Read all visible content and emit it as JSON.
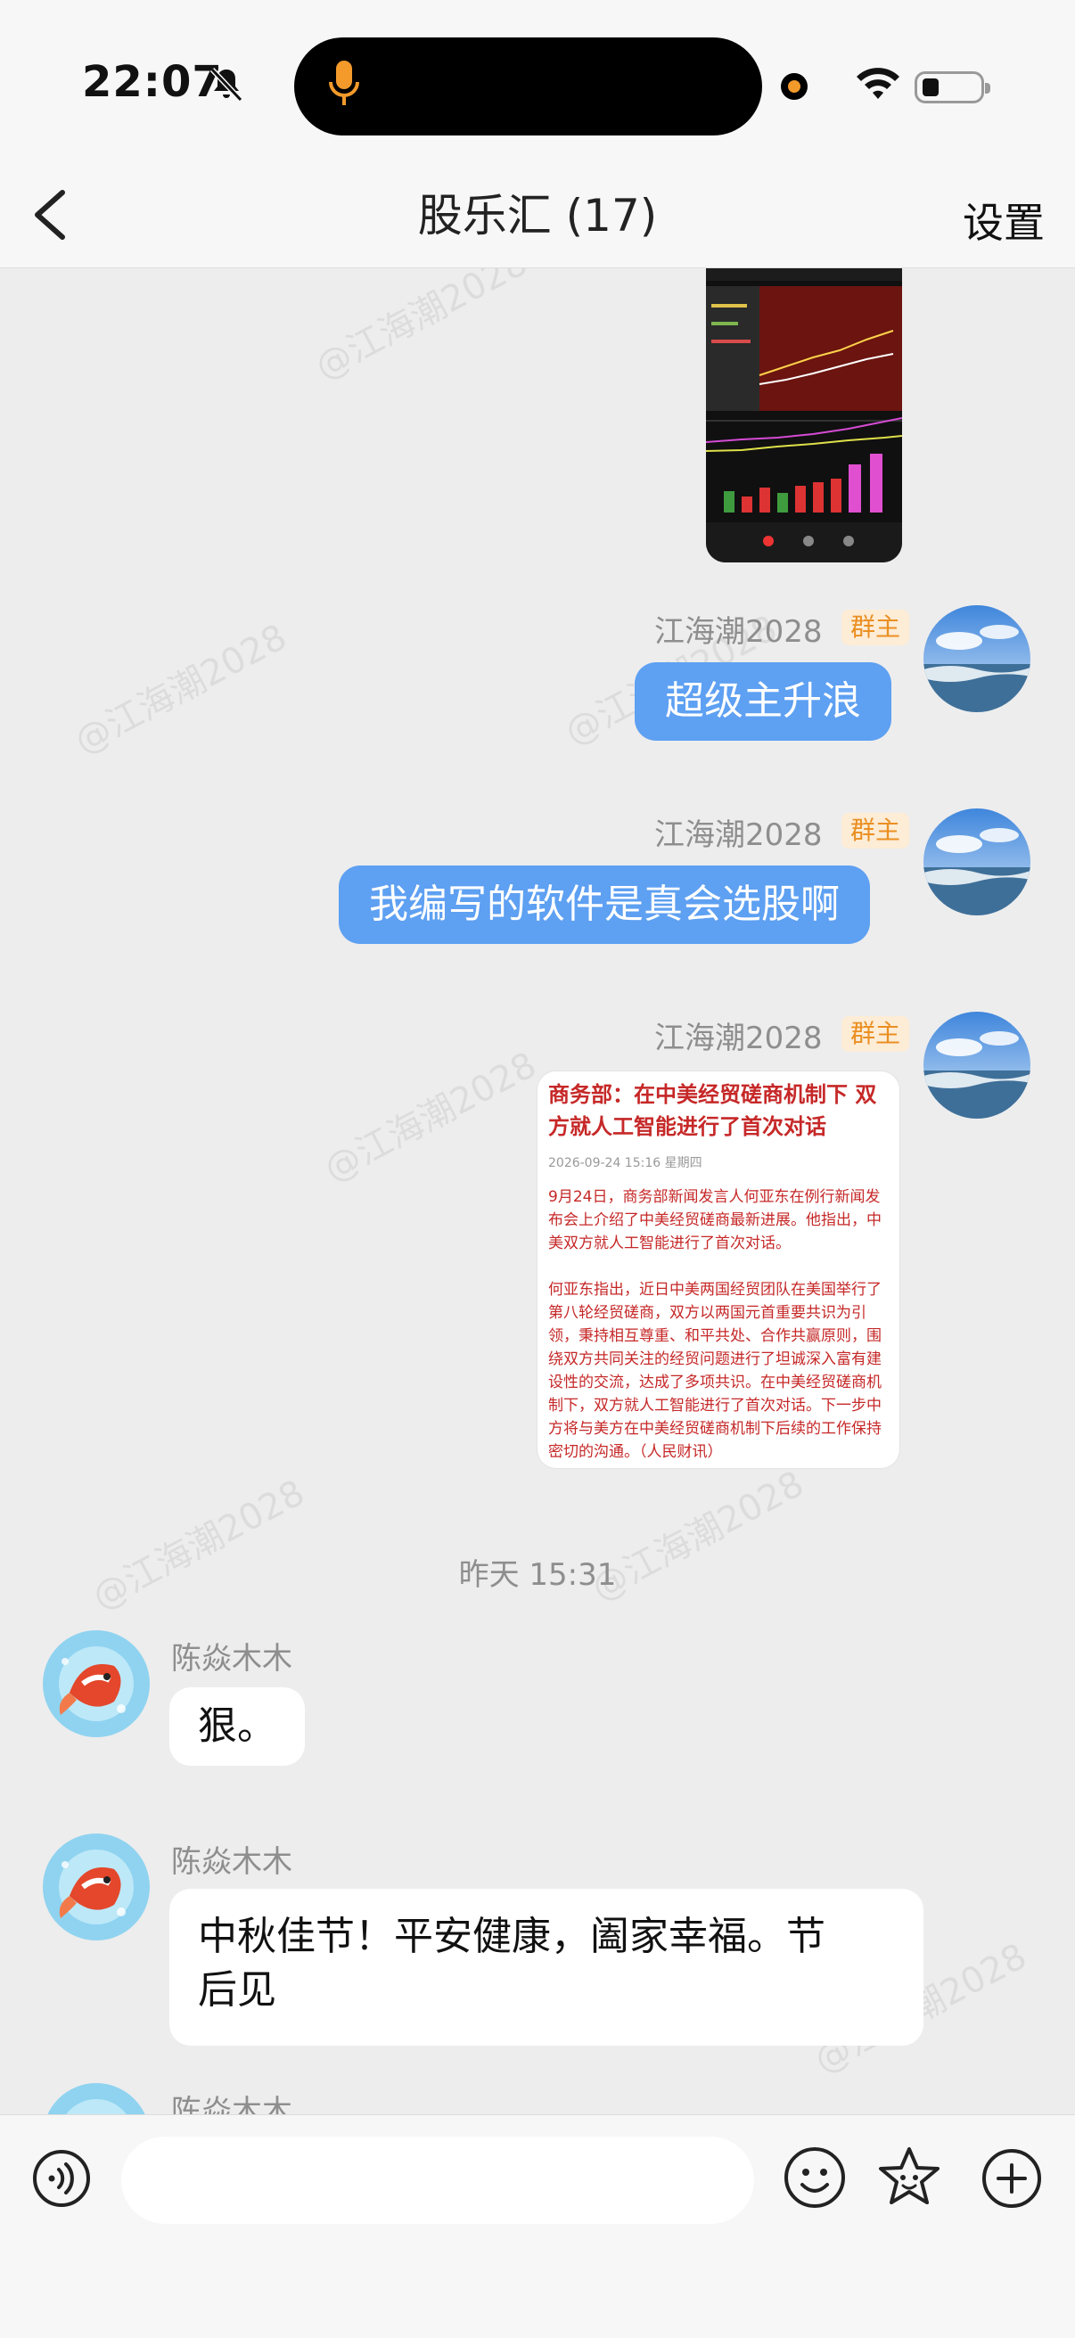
{
  "status_bar": {
    "time": "22:07",
    "icons": [
      "bell-slash-icon",
      "microphone-icon",
      "recording-dot-icon",
      "wifi-icon",
      "battery-icon"
    ]
  },
  "nav": {
    "back_icon": "chevron-left-icon",
    "title": "股乐汇 (17)",
    "settings_label": "设置"
  },
  "watermark_text": "@江海潮2028",
  "messages": [
    {
      "id": "m1",
      "side": "right",
      "sender": "江海潮2028",
      "role": "群主",
      "type": "text",
      "text": "超级主升浪"
    },
    {
      "id": "m2",
      "side": "right",
      "sender": "江海潮2028",
      "role": "群主",
      "type": "text",
      "text": "我编写的软件是真会选股啊"
    },
    {
      "id": "m3",
      "side": "right",
      "sender": "江海潮2028",
      "role": "群主",
      "type": "image",
      "news": {
        "title": "商务部：在中美经贸磋商机制下 双方就人工智能进行了首次对话",
        "date": "2026-09-24 15:16 星期四",
        "para1": "9月24日，商务部新闻发言人何亚东在例行新闻发布会上介绍了中美经贸磋商最新进展。他指出，中美双方就人工智能进行了首次对话。",
        "para2": "何亚东指出，近日中美两国经贸团队在美国举行了第八轮经贸磋商，双方以两国元首重要共识为引领，秉持相互尊重、和平共处、合作共赢原则，围绕双方共同关注的经贸问题进行了坦诚深入富有建设性的交流，达成了多项共识。在中美经贸磋商机制下，双方就人工智能进行了首次对话。下一步中方将与美方在中美经贸磋商机制下后续的工作保持密切的沟通。（人民财讯）"
      }
    },
    {
      "id": "sep",
      "type": "time",
      "text": "昨天 15:31"
    },
    {
      "id": "m4",
      "side": "left",
      "sender": "陈焱木木",
      "type": "text",
      "text": "狠。"
    },
    {
      "id": "m5",
      "side": "left",
      "sender": "陈焱木木",
      "type": "text",
      "text_line1": "中秋佳节！平安健康，阖家幸福。节",
      "text_line2": "后见"
    },
    {
      "id": "m6",
      "side": "left",
      "sender": "陈焱木木"
    }
  ],
  "input_bar": {
    "voice_icon": "voice-icon",
    "placeholder": "",
    "emoji_icon": "emoji-icon",
    "sticker_icon": "sticker-icon",
    "plus_icon": "plus-icon"
  },
  "colors": {
    "bubble_blue": "#5ea0f2",
    "background": "#ededed",
    "badge_bg": "#fdecd6",
    "badge_text": "#ea8f22",
    "news_red": "#c62828"
  }
}
